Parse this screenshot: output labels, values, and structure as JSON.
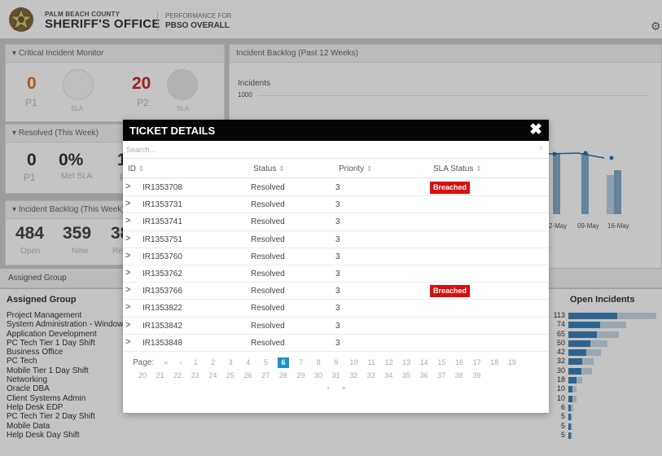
{
  "header": {
    "org_small": "PALM BEACH COUNTY",
    "org_big": "SHERIFF'S OFFICE",
    "perf_small": "PERFORMANCE FOR",
    "perf_big": "PBSO OVERALL"
  },
  "critical": {
    "title": "Critical Incident Monitor",
    "p1_value": "0",
    "p1_label": "P1",
    "p2_value": "20",
    "p2_label": "P2",
    "sla_label": "SLA"
  },
  "backlog": {
    "title": "Incident Backlog (Past 12 Weeks)",
    "y_label": "Incidents",
    "y_tick": "1000",
    "x_ticks": [
      "2-May",
      "09-May",
      "16-May"
    ]
  },
  "resolved": {
    "title": "Resolved (This Week)",
    "v1": "0",
    "v1_label": "P1",
    "v2": "0%",
    "v2_label": "Met SLA",
    "v3_partial": "1",
    "v3_label_partial": "P"
  },
  "backlog_week": {
    "title": "Incident Backlog (This Week)",
    "open": "484",
    "open_label": "Open",
    "new": "359",
    "new_label": "New",
    "res_partial": "38",
    "res_label_partial": "Reso"
  },
  "assigned": {
    "section_title": "Assigned Group",
    "col_group": "Assigned Group",
    "col_open": "Open Incidents",
    "groups": [
      {
        "name": "Project Management",
        "count": "113",
        "value": 113
      },
      {
        "name": "System Administration - Windows",
        "count": "74",
        "value": 74
      },
      {
        "name": "Application Development",
        "count": "65",
        "value": 65
      },
      {
        "name": "PC Tech Tier 1 Day Shift",
        "count": "50",
        "value": 50
      },
      {
        "name": "Business Office",
        "count": "42",
        "value": 42
      },
      {
        "name": "PC Tech",
        "count": "32",
        "value": 32
      },
      {
        "name": "Mobile Tier 1 Day Shift",
        "count": "30",
        "value": 30
      },
      {
        "name": "Networking",
        "count": "18",
        "value": 18
      },
      {
        "name": "Oracle DBA",
        "count": "10",
        "value": 10
      },
      {
        "name": "Client Systems Admin",
        "count": "10",
        "value": 10
      },
      {
        "name": "Help Desk EDP",
        "count": "6",
        "value": 6
      },
      {
        "name": "PC Tech Tier 2 Day Shift",
        "count": "5",
        "value": 5
      },
      {
        "name": "Mobile Data",
        "count": "5",
        "value": 5
      },
      {
        "name": "Help Desk Day Shift",
        "count": "5",
        "value": 5
      }
    ]
  },
  "modal": {
    "title": "TICKET DETAILS",
    "close": "✖",
    "search_placeholder": "Search...",
    "search_clear": "×",
    "columns": {
      "id": "ID",
      "status": "Status",
      "priority": "Priority",
      "sla": "SLA Status"
    },
    "sort_glyph": "⇕",
    "rows": [
      {
        "id": "IR1353708",
        "status": "Resolved",
        "priority": "3",
        "sla": "Breached"
      },
      {
        "id": "IR1353731",
        "status": "Resolved",
        "priority": "3",
        "sla": ""
      },
      {
        "id": "IR1353741",
        "status": "Resolved",
        "priority": "3",
        "sla": ""
      },
      {
        "id": "IR1353751",
        "status": "Resolved",
        "priority": "3",
        "sla": ""
      },
      {
        "id": "IR1353760",
        "status": "Resolved",
        "priority": "3",
        "sla": ""
      },
      {
        "id": "IR1353762",
        "status": "Resolved",
        "priority": "3",
        "sla": ""
      },
      {
        "id": "IR1353766",
        "status": "Resolved",
        "priority": "3",
        "sla": "Breached"
      },
      {
        "id": "IR1353822",
        "status": "Resolved",
        "priority": "3",
        "sla": ""
      },
      {
        "id": "IR1353842",
        "status": "Resolved",
        "priority": "3",
        "sla": ""
      },
      {
        "id": "IR1353848",
        "status": "Resolved",
        "priority": "3",
        "sla": ""
      }
    ],
    "pager": {
      "label": "Page:",
      "first": "«",
      "prev": "‹",
      "next": "›",
      "last": "»",
      "current": 6,
      "pages_row1": [
        "1",
        "2",
        "3",
        "4",
        "5",
        "6",
        "7",
        "8",
        "9",
        "10",
        "11",
        "12",
        "13",
        "14",
        "15",
        "16",
        "17",
        "18",
        "19"
      ],
      "pages_row2": [
        "20",
        "21",
        "22",
        "23",
        "24",
        "25",
        "26",
        "27",
        "28",
        "29",
        "30",
        "31",
        "32",
        "33",
        "34",
        "35",
        "36",
        "37",
        "38",
        "39"
      ]
    }
  },
  "colors": {
    "accent": "#1b92c5",
    "breached": "#d80f0f",
    "bar": "#3b7fb5",
    "p1_orange": "#e0701e",
    "p2_red": "#c62a2a"
  },
  "icons": {
    "gear": "gear-icon",
    "badge": "sheriff-star-badge-icon"
  }
}
